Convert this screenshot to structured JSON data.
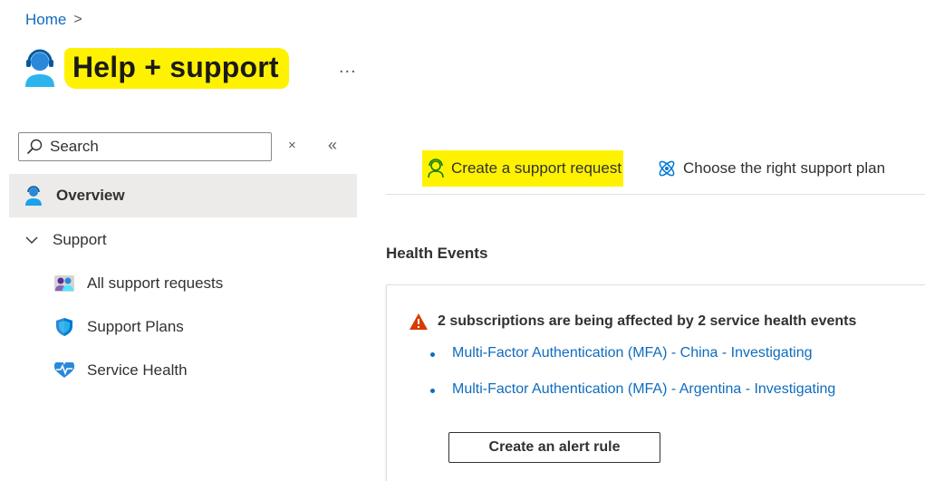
{
  "breadcrumb": {
    "home": "Home",
    "separator": ">"
  },
  "header": {
    "title": "Help + support",
    "more": "..."
  },
  "search": {
    "placeholder": "Search",
    "clear": "×",
    "collapse": "«"
  },
  "sidebar": {
    "overview": "Overview",
    "support": "Support",
    "items": [
      {
        "label": "All support requests",
        "icon": "people-icon"
      },
      {
        "label": "Support Plans",
        "icon": "shield-icon"
      },
      {
        "label": "Service Health",
        "icon": "heart-pulse-icon"
      }
    ]
  },
  "toolbar": {
    "create": "Create a support request",
    "plan": "Choose the right support plan"
  },
  "health": {
    "title": "Health Events",
    "warning": "2 subscriptions are being affected by 2 service health events",
    "events": [
      "Multi-Factor Authentication (MFA) - China - Investigating",
      "Multi-Factor Authentication (MFA) - Argentina - Investigating"
    ],
    "alert_button": "Create an alert rule"
  },
  "colors": {
    "accent": "#0f6cbd",
    "highlight": "#fff200",
    "warning": "#d83b01"
  }
}
